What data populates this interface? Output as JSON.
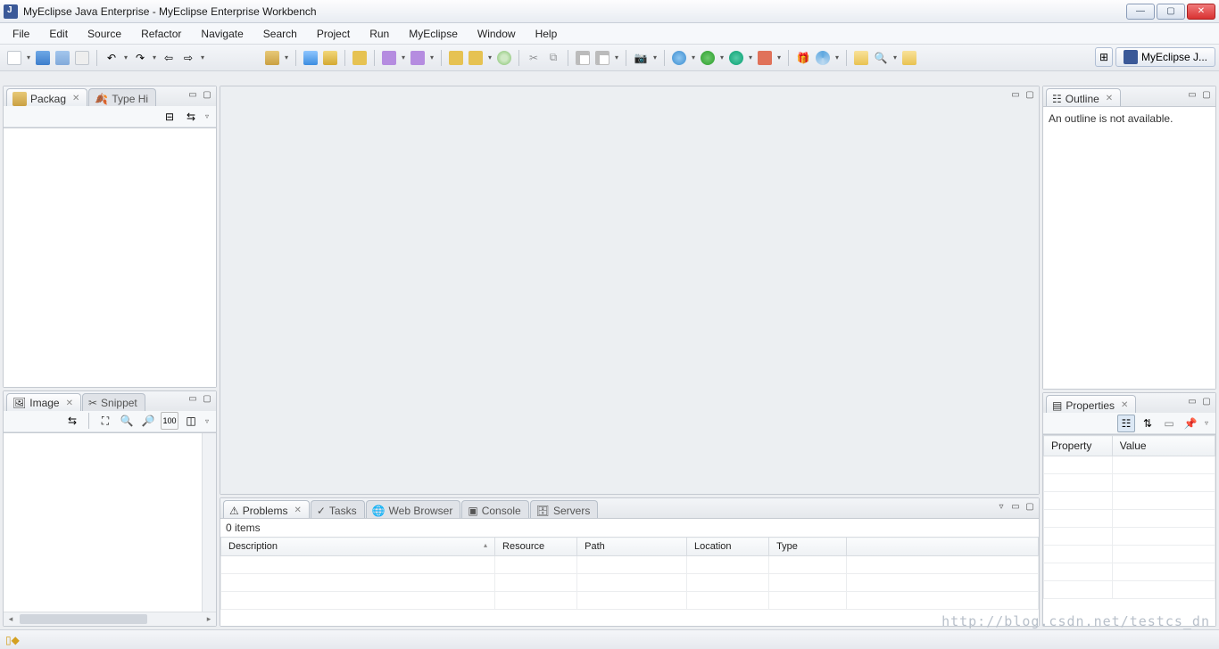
{
  "title": "MyEclipse Java Enterprise - MyEclipse Enterprise Workbench",
  "menus": [
    "File",
    "Edit",
    "Source",
    "Refactor",
    "Navigate",
    "Search",
    "Project",
    "Run",
    "MyEclipse",
    "Window",
    "Help"
  ],
  "perspective": {
    "label": "MyEclipse J..."
  },
  "left": {
    "package_tab": "Packag",
    "typehier_tab": "Type Hi",
    "image_tab": "Image",
    "snippet_tab": "Snippet"
  },
  "outline": {
    "tab": "Outline",
    "msg": "An outline is not available."
  },
  "properties": {
    "tab": "Properties",
    "cols": [
      "Property",
      "Value"
    ]
  },
  "problems": {
    "tabs": [
      "Problems",
      "Tasks",
      "Web Browser",
      "Console",
      "Servers"
    ],
    "count": "0 items",
    "cols": [
      "Description",
      "Resource",
      "Path",
      "Location",
      "Type"
    ]
  },
  "watermark": "http://blog.csdn.net/testcs_dn"
}
